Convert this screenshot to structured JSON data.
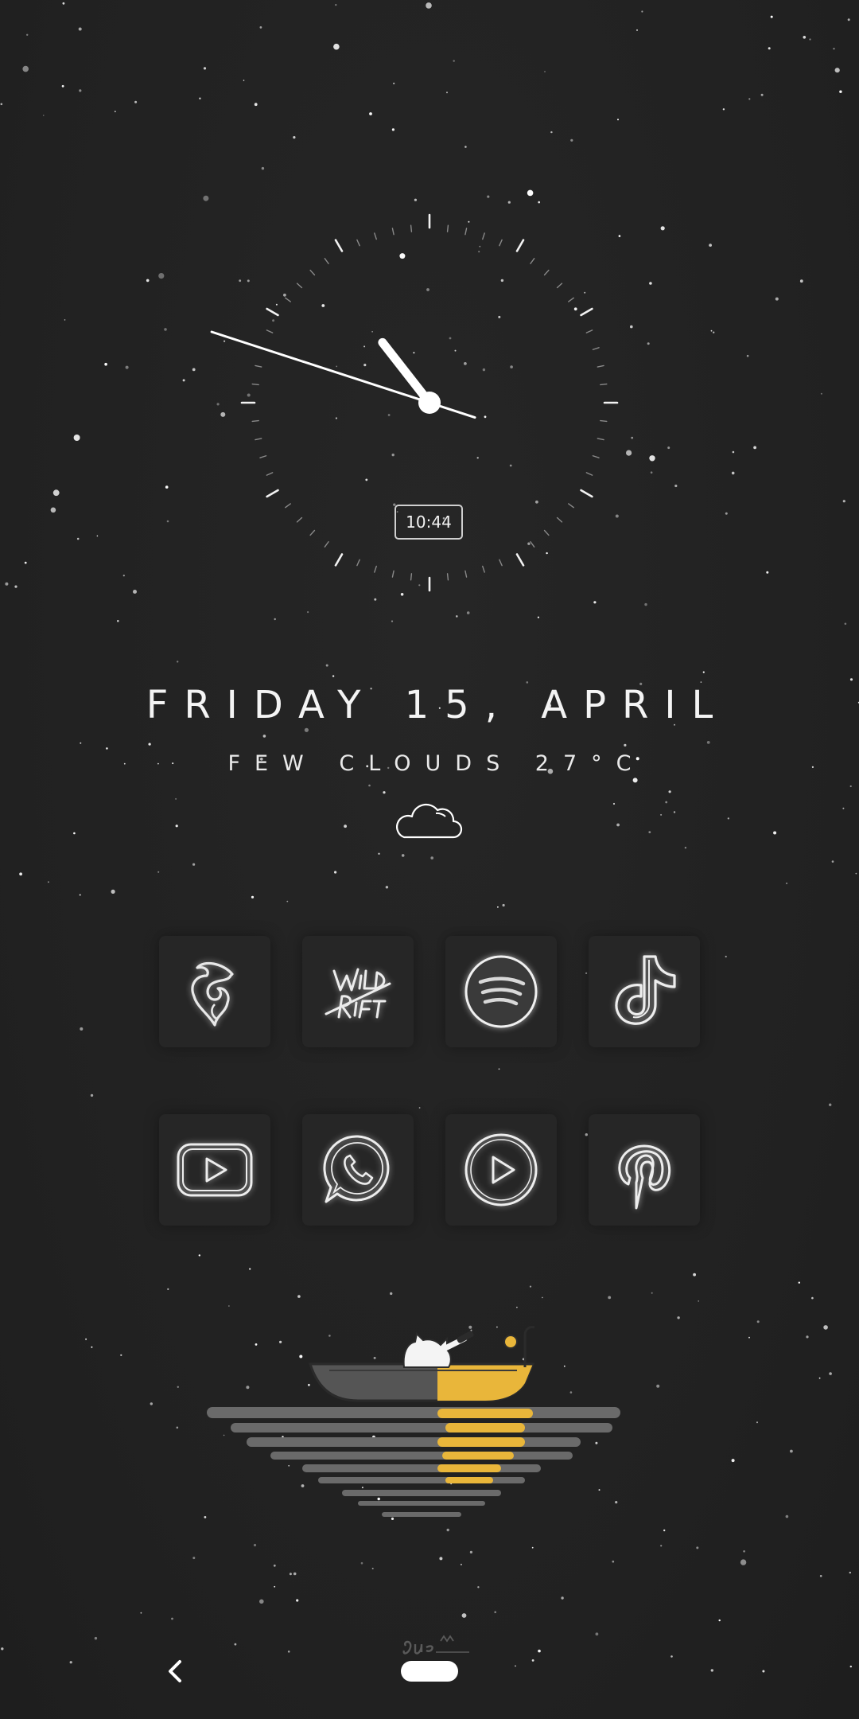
{
  "clock": {
    "digital_time": "10:44",
    "hour": 10,
    "minute": 44,
    "second": 48
  },
  "date": {
    "label": "FRIDAY 15, APRIL"
  },
  "weather": {
    "label": "FEW CLOUDS 27°C",
    "icon": "cloud-icon"
  },
  "apps": [
    {
      "name": "app-icon-flame",
      "icon": "flame-icon"
    },
    {
      "name": "app-icon-wild-rift",
      "icon": "wild-rift-icon"
    },
    {
      "name": "app-icon-spotify",
      "icon": "spotify-icon"
    },
    {
      "name": "app-icon-tiktok",
      "icon": "tiktok-icon"
    },
    {
      "name": "app-icon-youtube",
      "icon": "youtube-icon"
    },
    {
      "name": "app-icon-whatsapp",
      "icon": "whatsapp-icon"
    },
    {
      "name": "app-icon-play",
      "icon": "play-circle-icon"
    },
    {
      "name": "app-icon-pinterest",
      "icon": "pinterest-icon"
    }
  ],
  "nav": {
    "back_icon": "chevron-left-icon",
    "home_icon": "home-pill"
  },
  "colors": {
    "background": "#232323",
    "accent_yellow": "#e9b63a",
    "icon_stroke": "#e6e6e6"
  }
}
